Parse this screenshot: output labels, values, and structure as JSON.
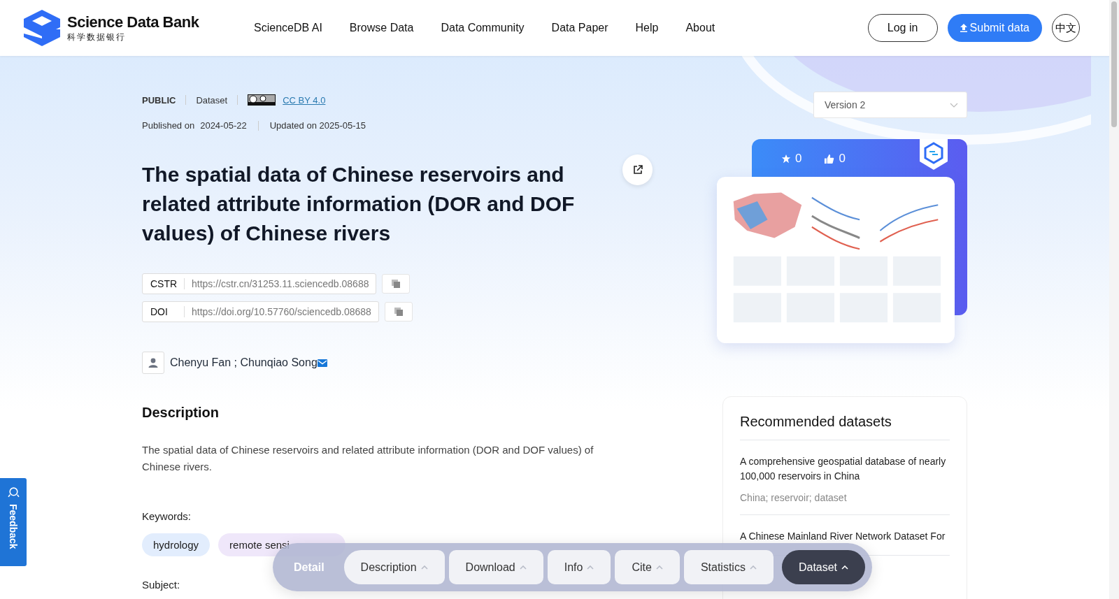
{
  "header": {
    "logo": {
      "name": "Science Data Bank",
      "subtitle": "科学数据银行"
    },
    "nav": [
      "ScienceDB AI",
      "Browse Data",
      "Data Community",
      "Data Paper",
      "Help",
      "About"
    ],
    "login": "Log in",
    "submit": "Submit data",
    "language": "中文"
  },
  "dataset": {
    "access": "PUBLIC",
    "type": "Dataset",
    "license": "CC BY 4.0",
    "published_label": "Published on",
    "published": "2024-05-22",
    "updated": "Updated on 2025-05-15",
    "title": "The spatial data of Chinese reservoirs and related attribute information (DOR and DOF values) of Chinese rivers",
    "identifiers": [
      {
        "label": "CSTR",
        "value": "https://cstr.cn/31253.11.sciencedb.08688"
      },
      {
        "label": "DOI",
        "value": "https://doi.org/10.57760/sciencedb.08688"
      }
    ],
    "authors": "Chenyu Fan ; Chunqiao Song",
    "description_heading": "Description",
    "description": "The spatial data of Chinese reservoirs and related attribute information (DOR and DOF values) of Chinese rivers.",
    "keywords_label": "Keywords:",
    "keywords": [
      "hydrology",
      "remote sensi"
    ],
    "subject_label": "Subject:"
  },
  "sidebar": {
    "version": "Version 2",
    "favorites": "0",
    "likes": "0",
    "recommended_title": "Recommended datasets",
    "recommended": [
      {
        "title": "A comprehensive geospatial database of nearly 100,000 reservoirs in China",
        "tags": "China; reservoir; dataset"
      },
      {
        "title": "A Chinese Mainland River Network Dataset For"
      }
    ]
  },
  "toolbar": {
    "label": "Detail",
    "tabs": [
      {
        "label": "Description",
        "selected": false
      },
      {
        "label": "Download",
        "selected": false
      },
      {
        "label": "Info",
        "selected": false
      },
      {
        "label": "Cite",
        "selected": false
      },
      {
        "label": "Statistics",
        "selected": false
      },
      {
        "label": "Dataset",
        "selected": true
      }
    ]
  },
  "feedback": "Feedback"
}
